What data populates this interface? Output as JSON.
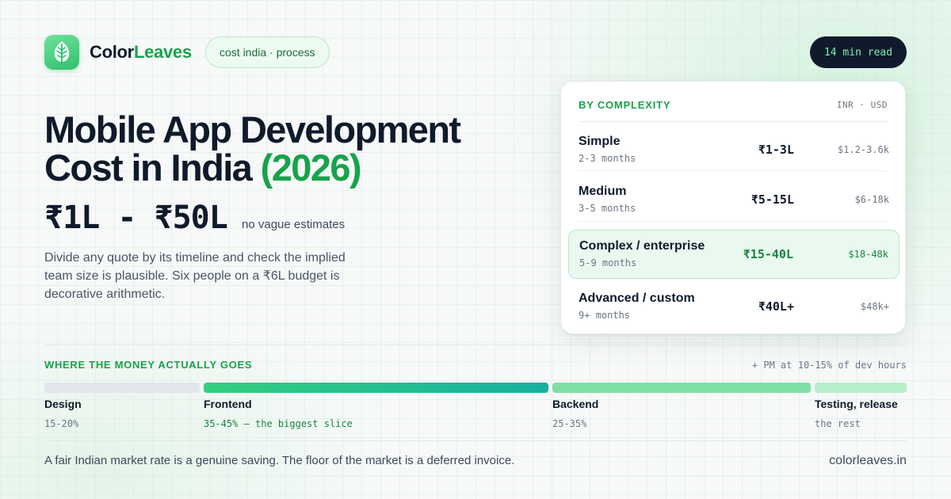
{
  "brand": {
    "name_part1": "Color",
    "name_part2": "Leaves",
    "tag": "cost india · process",
    "logo_icon": "leaf-icon",
    "accent_color": "#17a34a"
  },
  "read_time": "14 min read",
  "hero": {
    "headline_line1": "Mobile App Development",
    "headline_line2": "Cost in India",
    "headline_year": "(2026)",
    "price_range": "₹1L - ₹50L",
    "price_note": "no vague estimates",
    "description": "Divide any quote by its timeline and check the implied team size is plausible. Six people on a ₹6L budget is decorative arithmetic."
  },
  "complexity": {
    "title": "BY COMPLEXITY",
    "currency_label": "INR · USD",
    "tiers": [
      {
        "name": "Simple",
        "duration": "2-3 months",
        "inr": "₹1-3L",
        "usd": "$1.2-3.6k",
        "highlighted": false
      },
      {
        "name": "Medium",
        "duration": "3-5 months",
        "inr": "₹5-15L",
        "usd": "$6-18k",
        "highlighted": false
      },
      {
        "name": "Complex / enterprise",
        "duration": "5-9 months",
        "inr": "₹15-40L",
        "usd": "$18-48k",
        "highlighted": true
      },
      {
        "name": "Advanced / custom",
        "duration": "9+ months",
        "inr": "₹40L+",
        "usd": "$48k+",
        "highlighted": false
      }
    ]
  },
  "money": {
    "title": "WHERE THE MONEY ACTUALLY GOES",
    "note": "+ PM at 10-15% of dev hours",
    "segments": [
      {
        "label": "Design",
        "pct": "15-20%",
        "color": "#e3e6ec"
      },
      {
        "label": "Frontend",
        "pct": "35-45% — the biggest slice",
        "color": "#22b87a"
      },
      {
        "label": "Backend",
        "pct": "25-35%",
        "color": "#7fe0a6"
      },
      {
        "label": "Testing, release",
        "pct": "the rest",
        "color": "#b6efca"
      }
    ]
  },
  "footer": {
    "note": "A fair Indian market rate is a genuine saving. The floor of the market is a deferred invoice.",
    "site": "colorleaves.in"
  }
}
